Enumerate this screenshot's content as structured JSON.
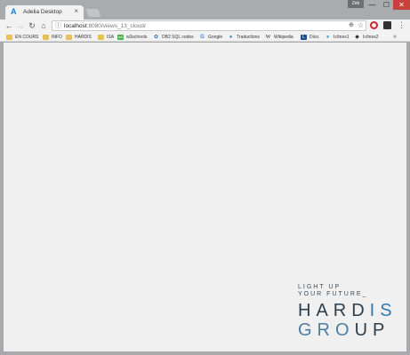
{
  "window": {
    "tab_icon": "A",
    "tab_title": "Adelia Desktop",
    "tab_close": "×",
    "user_badge": "Zeb",
    "minimize": "—",
    "maximize": "☐",
    "close": "✕"
  },
  "toolbar": {
    "back": "←",
    "forward": "→",
    "reload": "↻",
    "home": "⌂",
    "info_icon": "ⓘ",
    "url_host": "localhost",
    "url_rest": ":8080/views_13_cloud/",
    "zoom_icon": "⊕",
    "star_icon": "☆",
    "menu": "⋮"
  },
  "bookmarks": [
    {
      "label": "EN COURS",
      "icon": "folder-icon",
      "glyph": ""
    },
    {
      "label": "INFO",
      "icon": "folder-icon",
      "glyph": ""
    },
    {
      "label": "HARDIS",
      "icon": "folder-icon",
      "glyph": ""
    },
    {
      "label": "ISA",
      "icon": "folder-icon",
      "glyph": ""
    },
    {
      "label": "w3schools",
      "icon": "w3schools-icon",
      "glyph": "w3"
    },
    {
      "label": "DB2 SQL codes",
      "icon": "gear-icon",
      "glyph": "✿"
    },
    {
      "label": "Google",
      "icon": "google-icon",
      "glyph": "G"
    },
    {
      "label": "Traductions",
      "icon": "translate-icon",
      "glyph": "●"
    },
    {
      "label": "Wikipedia",
      "icon": "wikipedia-icon",
      "glyph": "W"
    },
    {
      "label": "Dico.",
      "icon": "dictionary-icon",
      "glyph": "L"
    },
    {
      "label": "Icônes1",
      "icon": "icons-icon",
      "glyph": "●"
    },
    {
      "label": "Icônes2",
      "icon": "tag-icon",
      "glyph": "◆"
    }
  ],
  "bookmarks_more": "»",
  "logo": {
    "tagline_1": "LIGHT UP",
    "tagline_2": "YOUR FUTURE_",
    "hardis_a": "HARD",
    "hardis_b": "IS",
    "group_a": "GRO",
    "group_b": "UP"
  }
}
